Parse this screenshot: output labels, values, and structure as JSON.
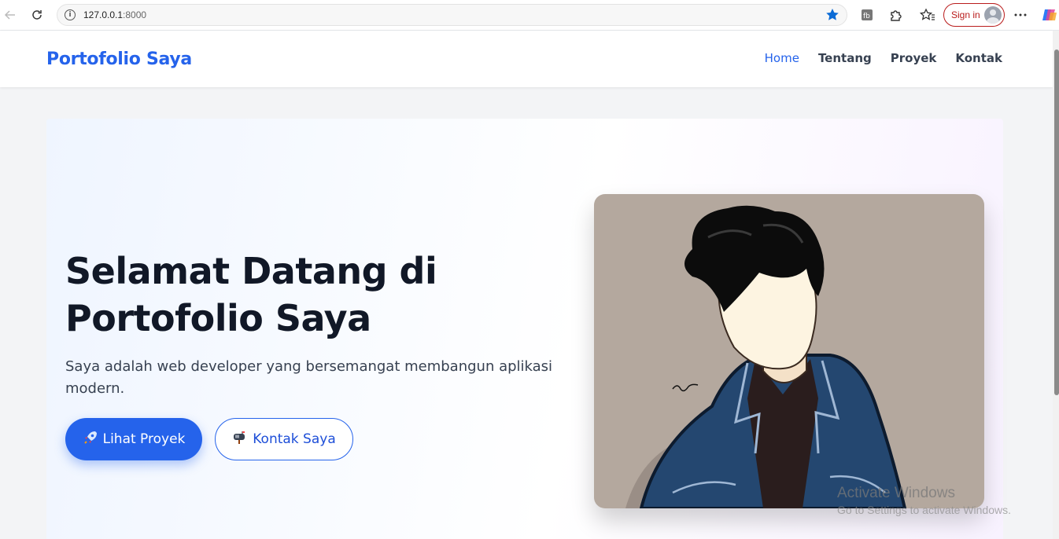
{
  "browser": {
    "url_host": "127.0.0.1",
    "url_port": ":8000",
    "sign_in": "Sign in"
  },
  "nav": {
    "brand": "Portofolio Saya",
    "links": [
      "Home",
      "Tentang",
      "Proyek",
      "Kontak"
    ],
    "active": "Home"
  },
  "hero": {
    "title_line1": "Selamat Datang di",
    "title_line2": "Portofolio Saya",
    "subtitle": "Saya adalah web developer yang bersemangat membangun aplikasi modern.",
    "primary_button": "Lihat Proyek",
    "secondary_button": "Kontak Saya"
  },
  "watermark": {
    "line1": "Activate Windows",
    "line2": "Go to Settings to activate Windows."
  },
  "colors": {
    "accent": "#2563eb",
    "title": "#111827",
    "portrait_bg": "#b4a89e"
  }
}
